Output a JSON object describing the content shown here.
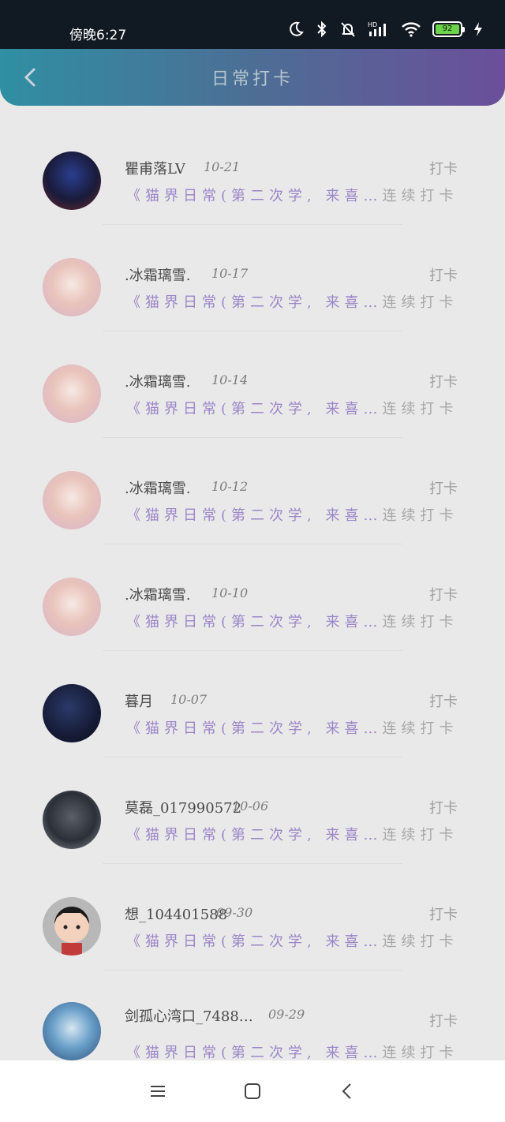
{
  "status_bar": {
    "time": "傍晚6:27",
    "battery": "92",
    "icons": [
      "moon-icon",
      "bluetooth-icon",
      "mute-bell-icon",
      "signal-hd-icon",
      "wifi-icon",
      "battery-icon",
      "charging-icon"
    ]
  },
  "header": {
    "title": "日常打卡",
    "back_icon": "chevron-left-icon"
  },
  "items": [
    {
      "name": "瞿甫落LV",
      "date": "10-21",
      "action": "打卡",
      "desc_prefix": "《猫界日常(第二次学, 来喜…",
      "desc_suffix": "连续打卡/实",
      "avatar": "dark-blue-anime"
    },
    {
      "name": ".冰霜璃雪.",
      "date": "10-17",
      "action": "打卡",
      "desc_prefix": "《猫界日常(第二次学, 来喜…",
      "desc_suffix": "连续打卡/实",
      "avatar": "pink-anime"
    },
    {
      "name": ".冰霜璃雪.",
      "date": "10-14",
      "action": "打卡",
      "desc_prefix": "《猫界日常(第二次学, 来喜…",
      "desc_suffix": "连续打卡/实",
      "avatar": "pink-anime"
    },
    {
      "name": ".冰霜璃雪.",
      "date": "10-12",
      "action": "打卡",
      "desc_prefix": "《猫界日常(第二次学, 来喜…",
      "desc_suffix": "连续打卡/实",
      "avatar": "pink-anime"
    },
    {
      "name": ".冰霜璃雪.",
      "date": "10-10",
      "action": "打卡",
      "desc_prefix": "《猫界日常(第二次学, 来喜…",
      "desc_suffix": "连续打卡/实",
      "avatar": "pink-anime"
    },
    {
      "name": "暮月",
      "date": "10-07",
      "action": "打卡",
      "desc_prefix": "《猫界日常(第二次学, 来喜…",
      "desc_suffix": "连续打卡/实",
      "avatar": "dark-night"
    },
    {
      "name": "莫磊_017990572",
      "date": "10-06",
      "action": "打卡",
      "desc_prefix": "《猫界日常(第二次学, 来喜…",
      "desc_suffix": "连续打卡/实",
      "avatar": "dark-warrior"
    },
    {
      "name": "想_104401588",
      "date": "09-30",
      "action": "打卡",
      "desc_prefix": "《猫界日常(第二次学, 来喜…",
      "desc_suffix": "连续打卡/实",
      "avatar": "cartoon-boy"
    },
    {
      "name": "剑孤心湾口_7488…",
      "date": "09-29",
      "action": "打卡",
      "desc_prefix": "《猫界日常(第二次学, 来喜…",
      "desc_suffix": "连续打卡/实",
      "avatar": "blue-white-anime"
    }
  ],
  "nav_bar": {
    "icons": [
      "menu-icon",
      "home-square-icon",
      "back-chevron-icon"
    ]
  },
  "colors": {
    "header_start": "#2f8fa3",
    "header_end": "#6b4f9a",
    "desc_purple": "#9b86c9",
    "background": "#e9e9e9"
  }
}
